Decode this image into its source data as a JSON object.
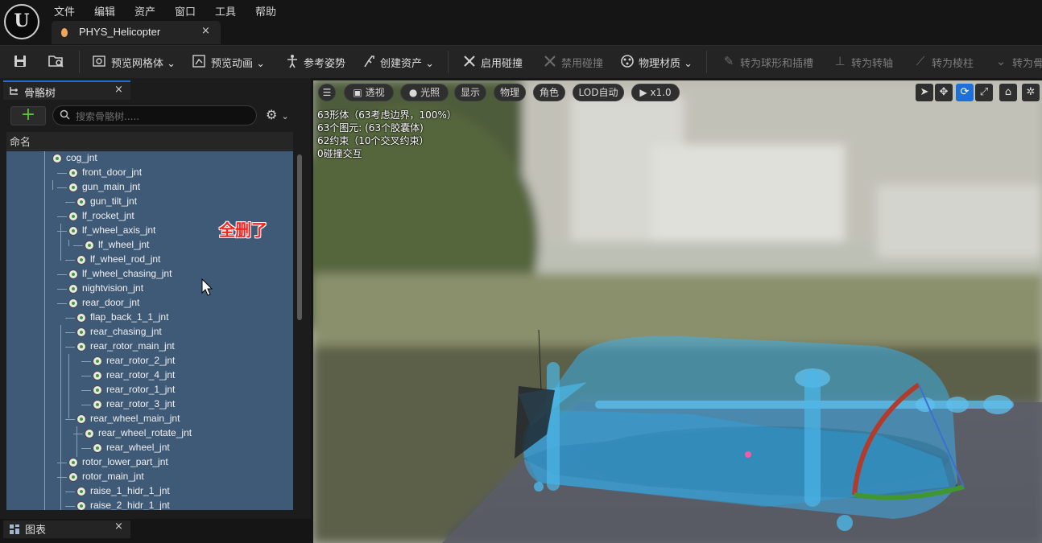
{
  "menu": [
    "文件",
    "编辑",
    "资产",
    "窗口",
    "工具",
    "帮助"
  ],
  "logo_text": "U",
  "document_tab": {
    "title": "PHYS_Helicopter",
    "close": "×"
  },
  "toolbar": {
    "preview_mesh": "预览网格体",
    "preview_anim": "预览动画",
    "ref_pose": "参考姿势",
    "create_asset": "创建资产",
    "enable_collision": "启用碰撞",
    "disable_collision": "禁用碰撞",
    "phys_material": "物理材质",
    "to_ball": "转为球形和插槽",
    "to_hinge": "转为转轴",
    "to_prismatic": "转为棱柱",
    "to_skeletal": "转为骨"
  },
  "skeleton_panel": {
    "tab_label": "骨骼树",
    "close": "×",
    "add": "+",
    "search_placeholder": "搜索骨骼树.....",
    "column_name": "命名",
    "bones": [
      {
        "name": "cog_jnt",
        "depth": 0
      },
      {
        "name": "front_door_jnt",
        "depth": 1
      },
      {
        "name": "gun_main_jnt",
        "depth": 1
      },
      {
        "name": "gun_tilt_jnt",
        "depth": 2
      },
      {
        "name": "lf_rocket_jnt",
        "depth": 1
      },
      {
        "name": "lf_wheel_axis_jnt",
        "depth": 1
      },
      {
        "name": "lf_wheel_jnt",
        "depth": 3
      },
      {
        "name": "lf_wheel_rod_jnt",
        "depth": 2
      },
      {
        "name": "lf_wheel_chasing_jnt",
        "depth": 1
      },
      {
        "name": "nightvision_jnt",
        "depth": 1
      },
      {
        "name": "rear_door_jnt",
        "depth": 1
      },
      {
        "name": "flap_back_1_1_jnt",
        "depth": 2
      },
      {
        "name": "rear_chasing_jnt",
        "depth": 2
      },
      {
        "name": "rear_rotor_main_jnt",
        "depth": 2
      },
      {
        "name": "rear_rotor_2_jnt",
        "depth": 4
      },
      {
        "name": "rear_rotor_4_jnt",
        "depth": 4
      },
      {
        "name": "rear_rotor_1_jnt",
        "depth": 4
      },
      {
        "name": "rear_rotor_3_jnt",
        "depth": 4
      },
      {
        "name": "rear_wheel_main_jnt",
        "depth": 2
      },
      {
        "name": "rear_wheel_rotate_jnt",
        "depth": 3
      },
      {
        "name": "rear_wheel_jnt",
        "depth": 4
      },
      {
        "name": "rotor_lower_part_jnt",
        "depth": 1
      },
      {
        "name": "rotor_main_jnt",
        "depth": 1
      },
      {
        "name": "raise_1_hidr_1_jnt",
        "depth": 2
      },
      {
        "name": "raise_2_hidr_1_jnt",
        "depth": 2
      }
    ]
  },
  "annotation": "全删了",
  "chart_panel": {
    "tab_label": "图表",
    "close": "×"
  },
  "viewport": {
    "perspective": "透视",
    "lit": "光照",
    "show": "显示",
    "physics": "物理",
    "character": "角色",
    "lod": "LOD自动",
    "speed": "x1.0",
    "stats": [
      "63形体（63考虑边界，100%）",
      "63个图元: (63个胶囊体)",
      "62约束（10个交叉约束）",
      "0碰撞交互"
    ]
  },
  "colors": {
    "selection_blue": "#3f5a77",
    "accent": "#1e6fd8",
    "bone_dot": "#3e9c2b",
    "annotation_red": "#ff2020"
  }
}
